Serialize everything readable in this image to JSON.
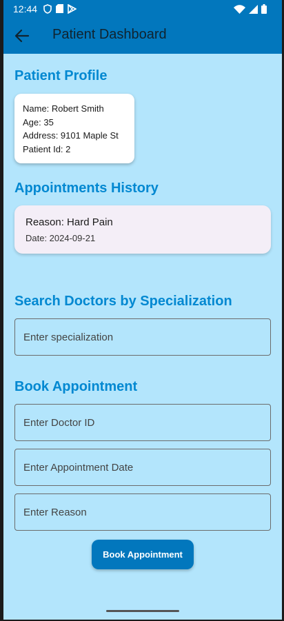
{
  "status_bar": {
    "time": "12:44",
    "icons_left": [
      "shield-icon",
      "sd-card-icon",
      "play-store-icon"
    ],
    "icons_right": [
      "wifi-icon",
      "signal-icon",
      "battery-icon"
    ]
  },
  "app_bar": {
    "title": "Patient Dashboard",
    "back_icon": "arrow-back-icon",
    "color": "#0277bd"
  },
  "profile": {
    "section_title": "Patient Profile",
    "name": "Name: Robert Smith",
    "age": "Age: 35",
    "address": "Address: 9101 Maple St",
    "patient_id": "Patient Id: 2"
  },
  "history": {
    "section_title": "Appointments History",
    "items": [
      {
        "reason": "Reason: Hard Pain",
        "date": "Date: 2024-09-21"
      }
    ]
  },
  "search": {
    "section_title": "Search Doctors by Specialization",
    "placeholder": "Enter specialization"
  },
  "booking": {
    "section_title": "Book Appointment",
    "doctor_id_placeholder": "Enter Doctor ID",
    "date_placeholder": "Enter Appointment Date",
    "reason_placeholder": "Enter Reason",
    "button_label": "Book Appointment"
  },
  "colors": {
    "background": "#b3e5fc",
    "accent": "#0288d1",
    "primary": "#0277bd"
  }
}
